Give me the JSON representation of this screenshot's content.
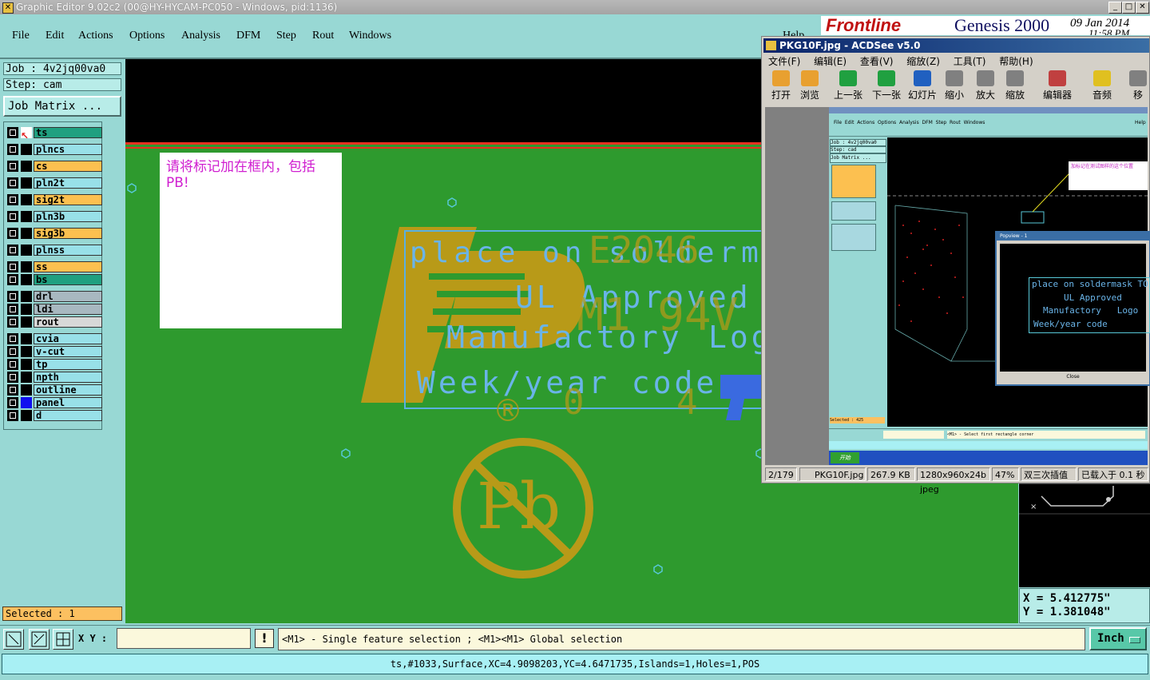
{
  "title_bar": {
    "title": "Graphic Editor 9.02c2 (00@HY-HYCAM-PC050 - Windows, pid:1136)",
    "min": "_",
    "max": "□",
    "close": "✕"
  },
  "menu": [
    "File",
    "Edit",
    "Actions",
    "Options",
    "Analysis",
    "DFM",
    "Step",
    "Rout",
    "Windows"
  ],
  "help_label": "Help",
  "job": {
    "job_line": "Job : 4v2jq00va0",
    "step_line": "Step: cam",
    "matrix_button": "Job Matrix ..."
  },
  "layers": [
    {
      "name": "ts",
      "color": "#20a080",
      "active": true
    },
    {
      "name": "plncs",
      "color": "#98e0e8"
    },
    {
      "name": "cs",
      "color": "#fcc050"
    },
    {
      "name": "pln2t",
      "color": "#98e0e8"
    },
    {
      "name": "sig2t",
      "color": "#fcc050"
    },
    {
      "name": "pln3b",
      "color": "#98e0e8"
    },
    {
      "name": "sig3b",
      "color": "#fcc050"
    },
    {
      "name": "plnss",
      "color": "#98e0e8"
    },
    {
      "name": "ss",
      "color": "#fcc050"
    },
    {
      "name": "bs",
      "color": "#20a080"
    },
    {
      "name": "drl",
      "color": "#a8b8c0"
    },
    {
      "name": "ldi",
      "color": "#a8b8c0"
    },
    {
      "name": "rout",
      "color": "#d8d8d8"
    },
    {
      "name": "cvia",
      "color": "#98e0e8"
    },
    {
      "name": "v-cut",
      "color": "#98e0e8"
    },
    {
      "name": "tp",
      "color": "#98e0e8"
    },
    {
      "name": "npth",
      "color": "#98e0e8"
    },
    {
      "name": "outline",
      "color": "#98e0e8"
    },
    {
      "name": "panel",
      "color": "#98e0e8",
      "swatch": "#1010f0"
    },
    {
      "name": "d",
      "color": "#98e0e8"
    }
  ],
  "selected_text": "Selected : 1",
  "canvas": {
    "note": "请将标记加在框内，包括PB!",
    "texts": [
      "place on soldermask",
      "E2046",
      "UL Approved",
      "M1 94V",
      "Manufactory",
      "Log",
      "Week/year code",
      "®",
      "0",
      "4",
      "Pb"
    ]
  },
  "genesis": {
    "brand": "Frontline",
    "product": "Genesis 2000",
    "date": "09 Jan 2014",
    "time": "11:58 PM"
  },
  "coordinates": {
    "x": "X =  5.412775\"",
    "y": "Y =  1.381048\""
  },
  "acdsee": {
    "title": "PKG10F.jpg - ACDSee v5.0",
    "menu": [
      "文件(F)",
      "编辑(E)",
      "查看(V)",
      "缩放(Z)",
      "工具(T)",
      "帮助(H)"
    ],
    "tools": [
      "打开",
      "浏览",
      "上一张",
      "下一张",
      "幻灯片",
      "缩小",
      "放大",
      "缩放",
      "编辑器",
      "音频",
      "移"
    ],
    "status": [
      "2/179",
      "PKG10F.jpg",
      "267.9 KB",
      "1280x960x24b jpeg",
      "47%",
      "双三次插值",
      "已载入于 0.1 秒"
    ],
    "inner": {
      "note": "加标记在测试图样的这个位置",
      "popup_title": "Popview - 1",
      "popup_lines": [
        "place on soldermask TO",
        "UL Approved",
        "Manufactory   Logo",
        "Week/year code"
      ],
      "close": "Close",
      "job": "Job : 4v2jq00va0",
      "step": "Step: cad",
      "matrix": "Job Matrix ...",
      "selected": "Selected : 425",
      "status": "<M1> - Select first rectangle corner",
      "taskbar_start": "开始"
    }
  },
  "toolbar": {
    "xy_label": "X Y :",
    "xy_value": "",
    "excl": "!",
    "message": "<M1> - Single feature selection ; <M1><M1> Global selection",
    "unit": "Inch"
  },
  "statusline": "ts,#1033,Surface,XC=4.9098203,YC=4.6471735,Islands=1,Holes=1,POS"
}
